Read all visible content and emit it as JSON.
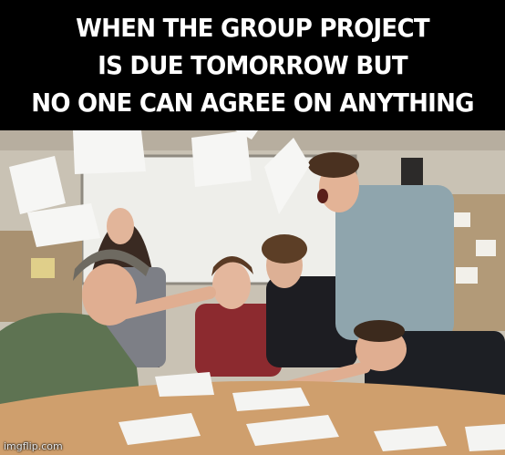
{
  "caption": {
    "text": "WHEN THE GROUP PROJECT\nIS DUE TOMORROW BUT\nNO ONE CAN AGREE ON ANYTHING",
    "color": "#ffffff",
    "background": "#000000"
  },
  "photo": {
    "scene": "meeting-room-argument-with-flying-papers"
  },
  "watermark": {
    "text": "imgflip.com"
  }
}
